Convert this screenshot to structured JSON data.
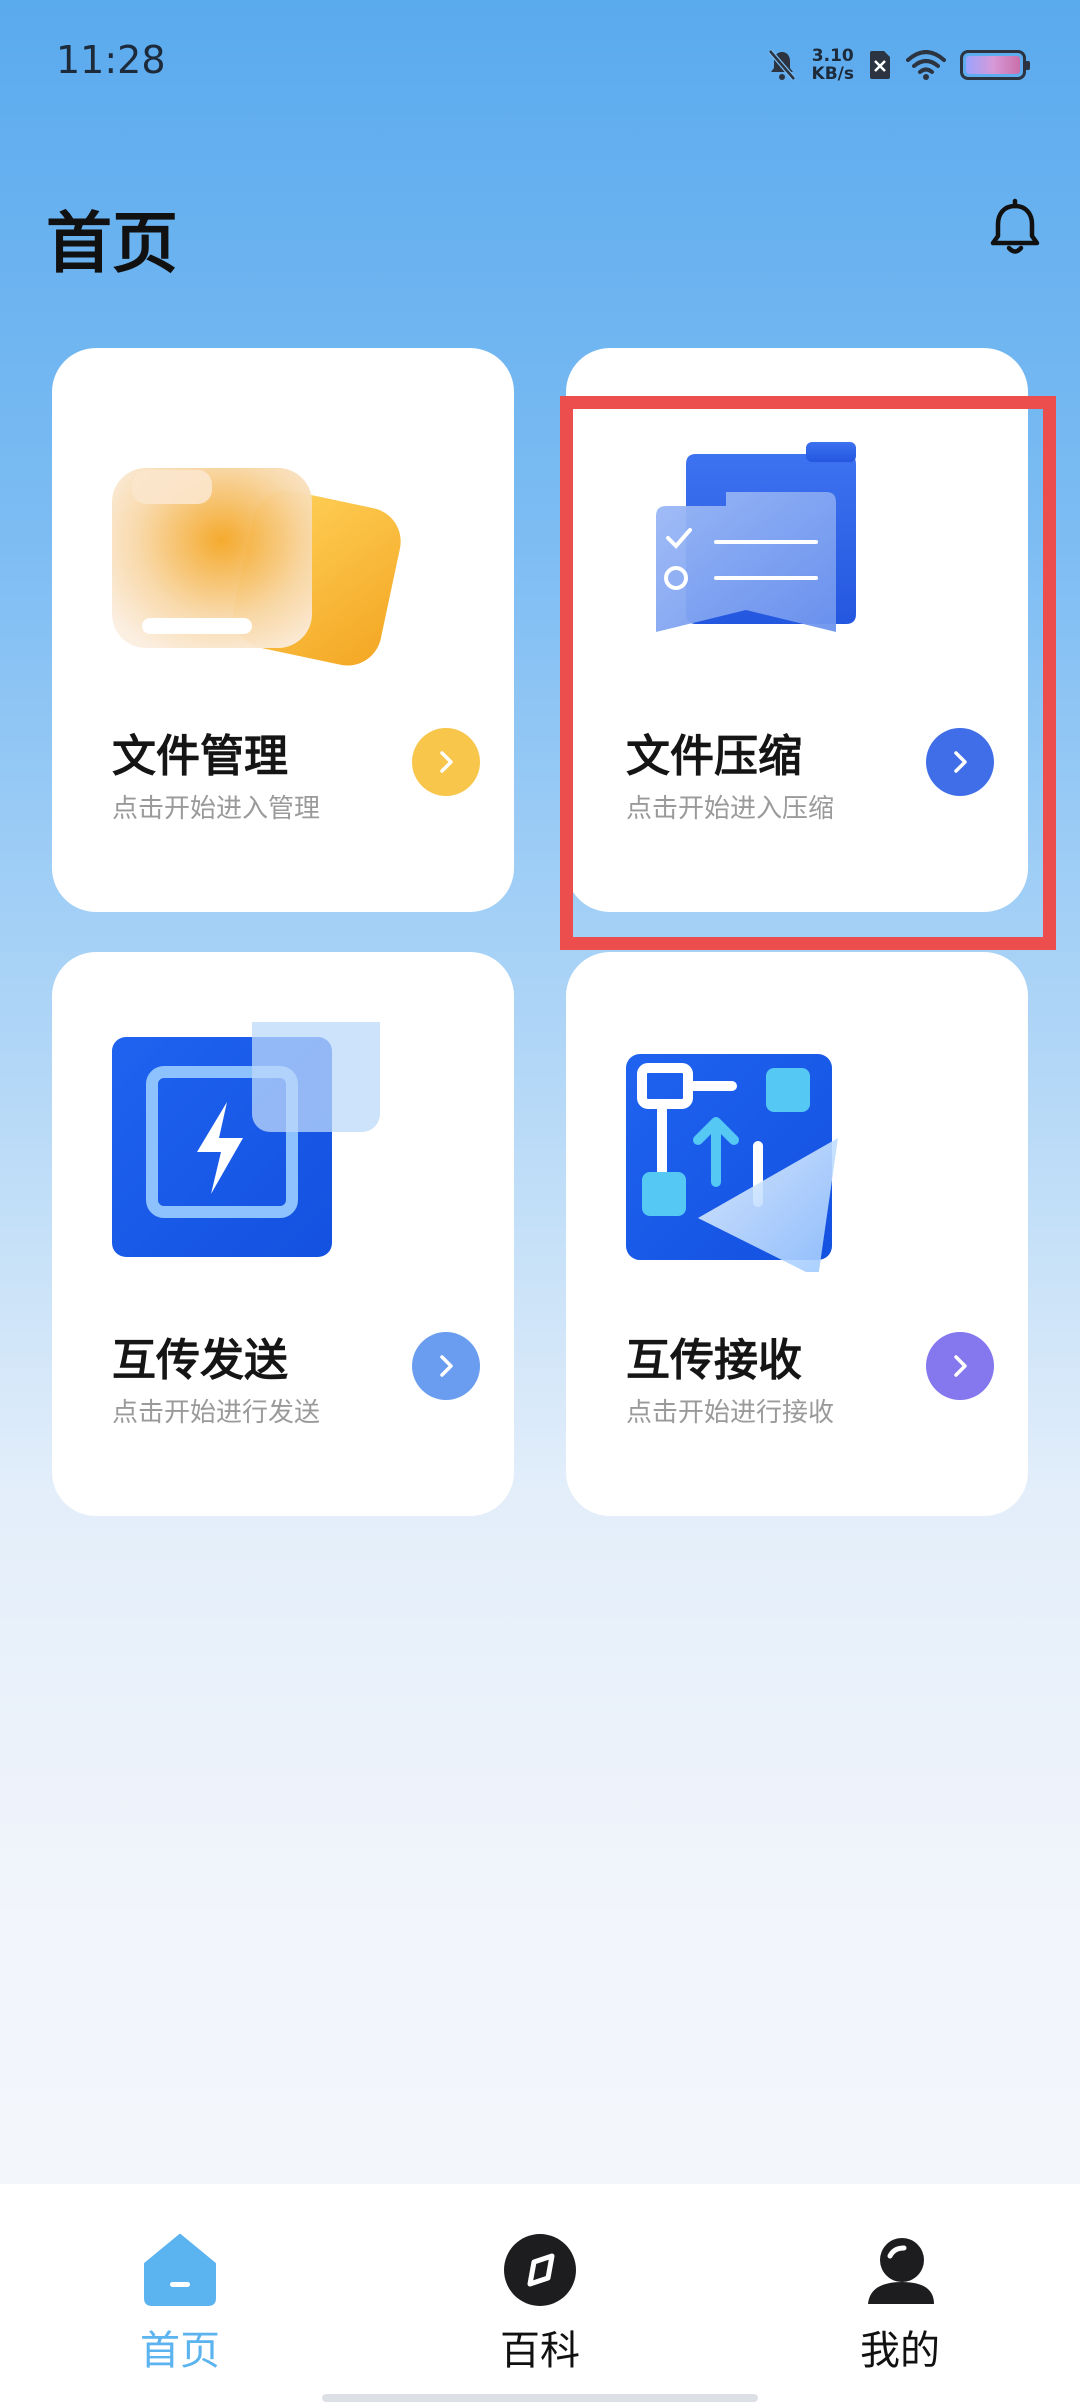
{
  "status_bar": {
    "time": "11:28",
    "net_speed_value": "3.10",
    "net_speed_unit": "KB/s",
    "icons": [
      "bell-muted-icon",
      "sim-off-icon",
      "wifi-icon",
      "battery-icon"
    ]
  },
  "header": {
    "title": "首页",
    "bell_icon": "bell-icon"
  },
  "cards": [
    {
      "title": "文件管理",
      "subtitle": "点击开始进入管理",
      "arrow_color": "#f7c64a",
      "icon": "folder-icon"
    },
    {
      "title": "文件压缩",
      "subtitle": "点击开始进入压缩",
      "arrow_color": "#3f6ee8",
      "icon": "compress-icon"
    },
    {
      "title": "互传发送",
      "subtitle": "点击开始进行发送",
      "arrow_color": "#6a9cf0",
      "icon": "send-icon"
    },
    {
      "title": "互传接收",
      "subtitle": "点击开始进行接收",
      "arrow_color": "#8577ee",
      "icon": "receive-icon"
    }
  ],
  "bottom_nav": {
    "items": [
      {
        "label": "首页",
        "icon": "home-icon",
        "active": true
      },
      {
        "label": "百科",
        "icon": "compass-icon",
        "active": false
      },
      {
        "label": "我的",
        "icon": "profile-icon",
        "active": false
      }
    ]
  },
  "colors": {
    "accent": "#5bb3ef",
    "highlight_border": "#ec4d4d"
  }
}
